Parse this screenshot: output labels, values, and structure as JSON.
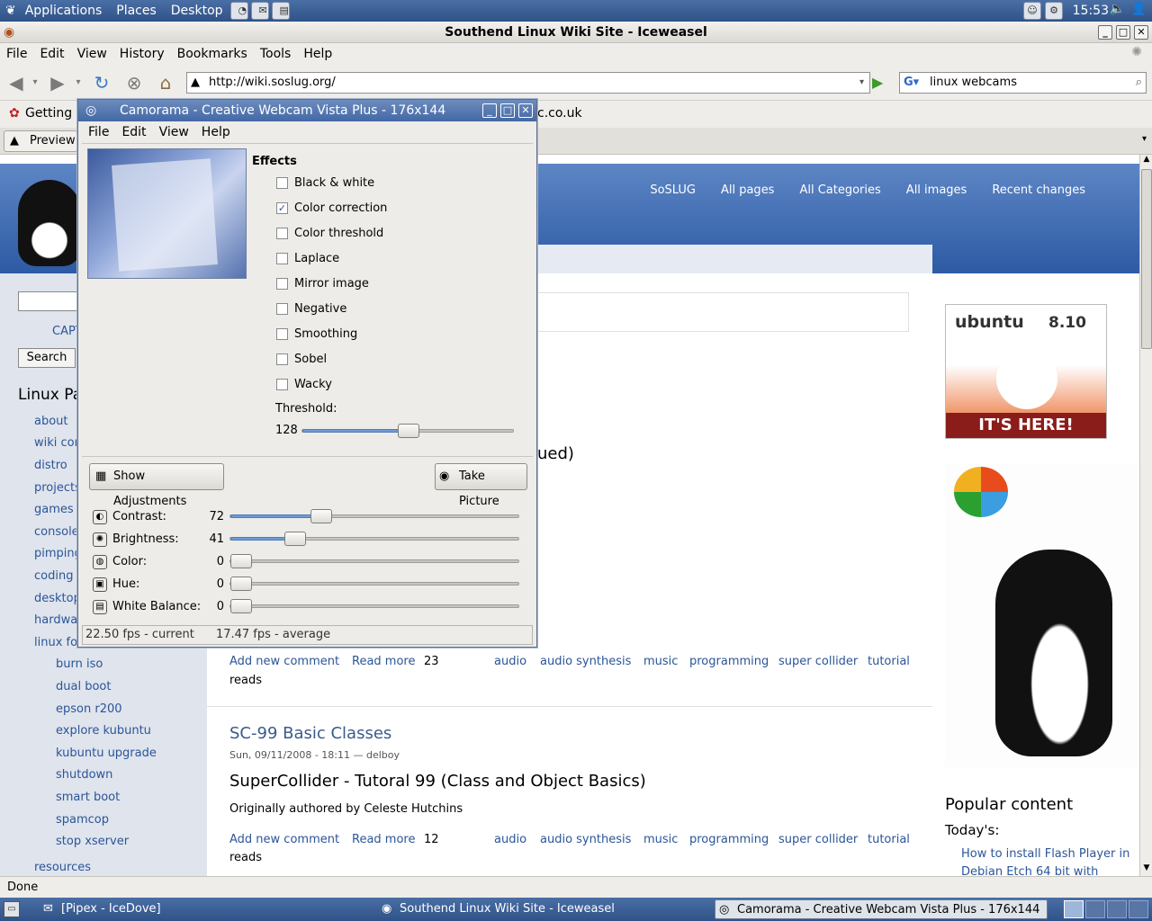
{
  "panel": {
    "applications": "Applications",
    "places": "Places",
    "desktop": "Desktop",
    "clock": "15:53"
  },
  "window": {
    "title": "Southend Linux Wiki Site - Iceweasel"
  },
  "menubar": [
    "File",
    "Edit",
    "View",
    "History",
    "Bookmarks",
    "Tools",
    "Help"
  ],
  "nav": {
    "url": "http://wiki.soslug.org/",
    "search": "linux webcams"
  },
  "bookmarks": {
    "getting_started": "Getting S",
    "right_item": "c.co.uk"
  },
  "tabs": {
    "preview": "Preview"
  },
  "site": {
    "topnav": [
      "SoSLUG",
      "All pages",
      "All Categories",
      "All images",
      "Recent changes"
    ],
    "captcha_link": "CAPT",
    "search_button": "Search",
    "left_heading": "Linux Pa",
    "left_links": [
      "about",
      "wiki cor",
      "distro",
      "projects",
      "games",
      "console",
      "pimping",
      "coding",
      "desktop",
      "hardwa",
      "linux fo"
    ],
    "sub_links": [
      "burn iso",
      "dual boot",
      "epson r200",
      "explore kubuntu",
      "kubuntu upgrade",
      "shutdown",
      "smart boot",
      "spamcop",
      "stop xserver"
    ],
    "resources": "resources",
    "content_partial": "ued)",
    "post1": {
      "add_comment": "Add new comment",
      "read_more": "Read more",
      "reads_count": "23",
      "reads": "reads",
      "tags": [
        "audio",
        "audio synthesis",
        "music",
        "programming",
        "super collider",
        "tutorial"
      ]
    },
    "post2": {
      "title": "SC-99 Basic Classes",
      "meta": "Sun, 09/11/2008 - 18:11 — delboy",
      "heading": "SuperCollider - Tutoral 99 (Class and Object Basics)",
      "body": "Originally authored by Celeste Hutchins",
      "add_comment": "Add new comment",
      "read_more": "Read more",
      "reads_count": "12",
      "reads": "reads",
      "tags": [
        "audio",
        "audio synthesis",
        "music",
        "programming",
        "super collider",
        "tutorial"
      ]
    },
    "ubuntu_ad": {
      "brand": "ubuntu",
      "version": "8.10",
      "cta": "IT'S HERE!"
    },
    "popular": {
      "heading": "Popular content",
      "today": "Today's:",
      "item1": "How to install Flash Player in Debian Etch 64 bit with"
    }
  },
  "status": {
    "text": "Done"
  },
  "taskbar": {
    "item1": "[Pipex - IceDove]",
    "item2": "Southend Linux Wiki Site - Iceweasel",
    "item3": "Camorama - Creative Webcam Vista Plus - 176x144"
  },
  "camorama": {
    "title": "Camorama - Creative Webcam Vista Plus - 176x144",
    "menu": [
      "File",
      "Edit",
      "View",
      "Help"
    ],
    "effects_heading": "Effects",
    "effects": [
      {
        "label": "Black & white",
        "checked": false
      },
      {
        "label": "Color correction",
        "checked": true
      },
      {
        "label": "Color threshold",
        "checked": false
      },
      {
        "label": "Laplace",
        "checked": false
      },
      {
        "label": "Mirror image",
        "checked": false
      },
      {
        "label": "Negative",
        "checked": false
      },
      {
        "label": "Smoothing",
        "checked": false
      },
      {
        "label": "Sobel",
        "checked": false
      },
      {
        "label": "Wacky",
        "checked": false
      }
    ],
    "threshold_label": "Threshold:",
    "threshold_value": "128",
    "threshold_fraction": 0.5,
    "show_adjustments": "Show Adjustments",
    "take_picture": "Take Picture",
    "adjustments": [
      {
        "label": "Contrast:",
        "value": "72",
        "fraction": 0.3
      },
      {
        "label": "Brightness:",
        "value": "41",
        "fraction": 0.2
      },
      {
        "label": "Color:",
        "value": "0",
        "fraction": 0
      },
      {
        "label": "Hue:",
        "value": "0",
        "fraction": 0
      },
      {
        "label": "White Balance:",
        "value": "0",
        "fraction": 0
      }
    ],
    "status_current": "22.50 fps - current",
    "status_average": "17.47 fps - average"
  }
}
